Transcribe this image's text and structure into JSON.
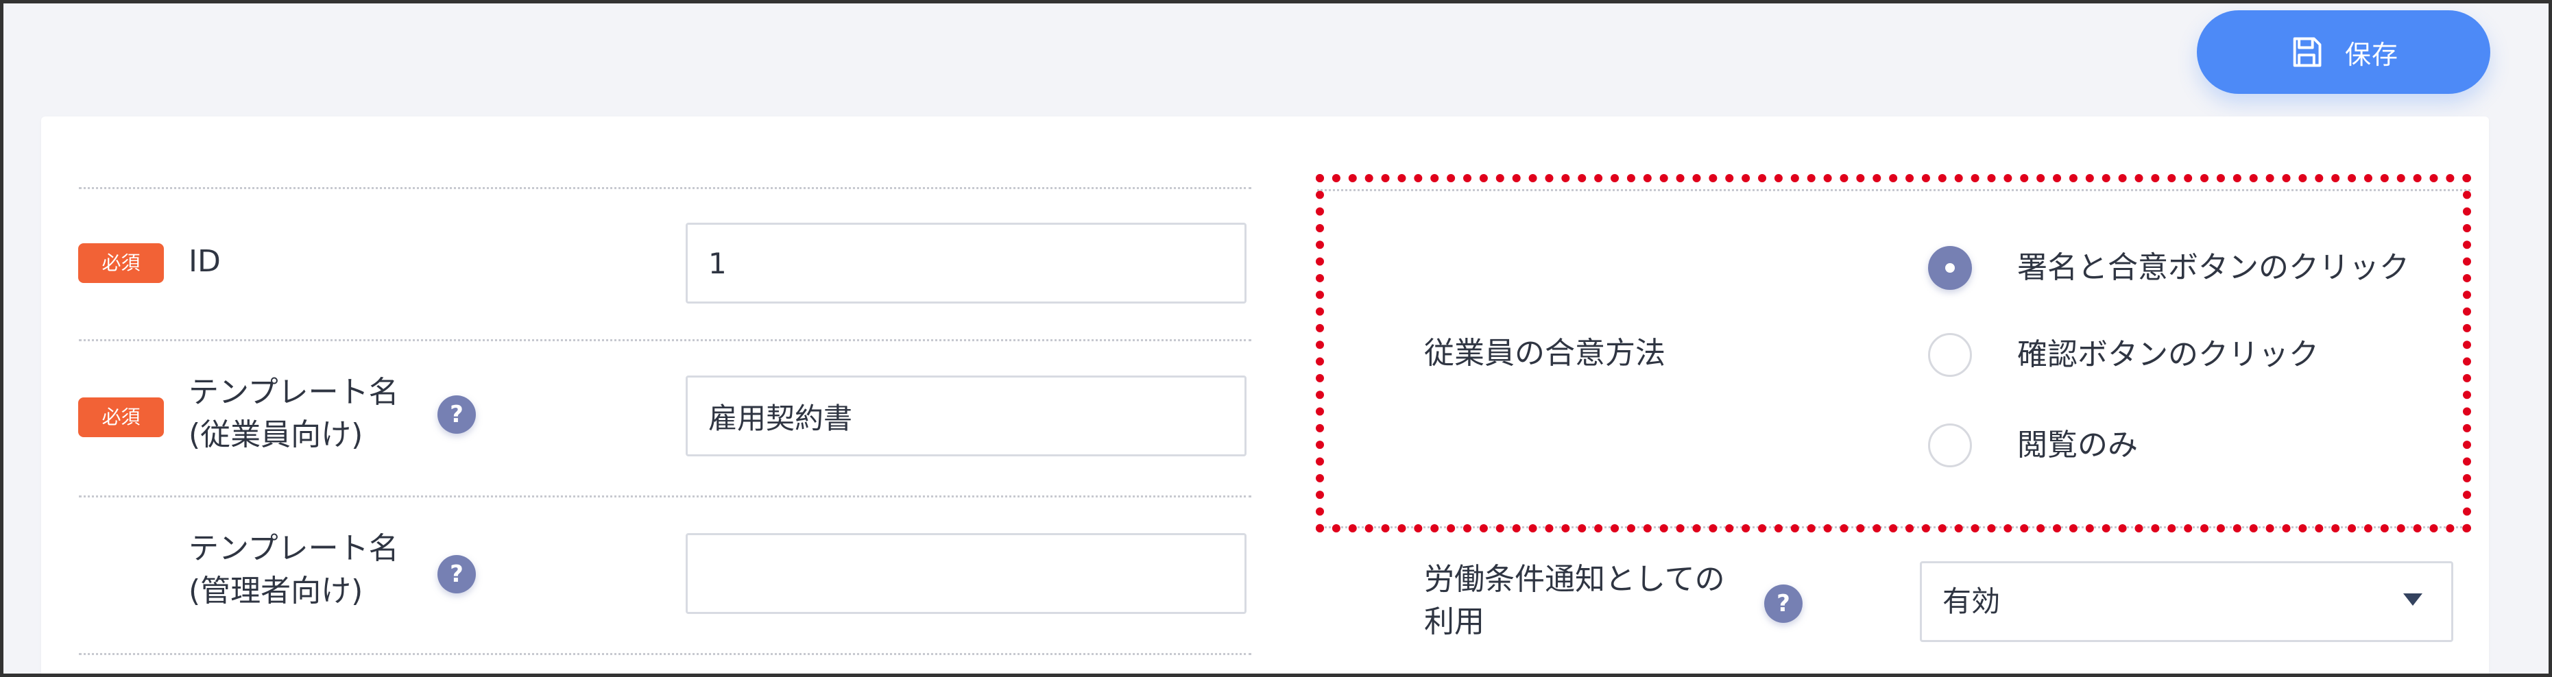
{
  "toolbar": {
    "save_label": "保存",
    "save_icon": "floppy-disk-icon"
  },
  "badges": {
    "required": "必須"
  },
  "form": {
    "id_label": "ID",
    "id_value": "1",
    "template_name_employee_label_1": "テンプレート名",
    "template_name_employee_label_2": "(従業員向け)",
    "template_name_employee_value": "雇用契約書",
    "template_name_admin_label_1": "テンプレート名",
    "template_name_admin_label_2": "(管理者向け)",
    "template_name_admin_value": ""
  },
  "consent": {
    "label": "従業員の合意方法",
    "options": [
      {
        "label": "署名と合意ボタンのクリック",
        "selected": true
      },
      {
        "label": "確認ボタンのクリック",
        "selected": false
      },
      {
        "label": "閲覧のみ",
        "selected": false
      }
    ]
  },
  "labor_notice": {
    "label_1": "労働条件通知としての",
    "label_2": "利用",
    "selected_value": "有効"
  },
  "help": {
    "symbol": "?"
  },
  "colors": {
    "primary": "#4d8af7",
    "required": "#f26236",
    "help": "#7680b3",
    "highlight": "#e0001b"
  }
}
